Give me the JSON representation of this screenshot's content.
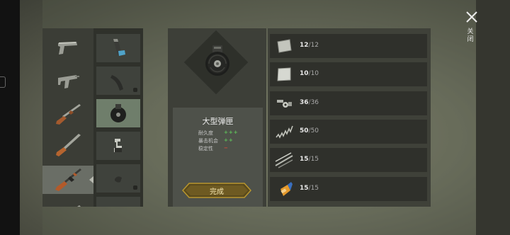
{
  "weapons": [
    {
      "icon": "pistol-icon",
      "active": false
    },
    {
      "icon": "uzi-icon",
      "active": false
    },
    {
      "icon": "shotgun-icon",
      "active": false
    },
    {
      "icon": "double-barrel-shotgun-icon",
      "active": false
    },
    {
      "icon": "assault-rifle-icon",
      "active": true
    },
    {
      "icon": "rifle-icon",
      "active": false
    }
  ],
  "parts": [
    {
      "icon": "magazine-icon",
      "selected": false,
      "locked": false
    },
    {
      "icon": "curved-magazine-icon",
      "selected": false,
      "locked": true
    },
    {
      "icon": "drum-magazine-icon",
      "selected": true,
      "locked": false
    },
    {
      "icon": "scope-mount-icon",
      "selected": false,
      "locked": false
    },
    {
      "icon": "grip-icon",
      "selected": false,
      "locked": true
    },
    {
      "icon": "part-icon",
      "selected": false,
      "locked": false
    }
  ],
  "detail": {
    "item_name": "大型弹匣",
    "stats": [
      {
        "label": "耐久度",
        "value": "+++",
        "color": "#5fc05a"
      },
      {
        "label": "暴击机会",
        "value": "++",
        "color": "#5fc05a"
      },
      {
        "label": "稳定性",
        "value": "−",
        "color": "#d84a3a"
      }
    ],
    "done_button": "完成"
  },
  "materials": [
    {
      "icon": "metal-plate-icon",
      "have": "12",
      "need": "12"
    },
    {
      "icon": "steel-sheet-icon",
      "have": "10",
      "need": "10"
    },
    {
      "icon": "nuts-bolts-icon",
      "have": "36",
      "need": "36"
    },
    {
      "icon": "spring-icon",
      "have": "50",
      "need": "50"
    },
    {
      "icon": "metal-rods-icon",
      "have": "15",
      "need": "15"
    },
    {
      "icon": "glue-tube-icon",
      "have": "15",
      "need": "15"
    }
  ],
  "close": {
    "label": "关闭"
  },
  "colors": {
    "accent_gold": "#b8962e",
    "selected_slot": "#6f7e6b",
    "positive": "#5fc05a",
    "negative": "#d84a3a"
  }
}
